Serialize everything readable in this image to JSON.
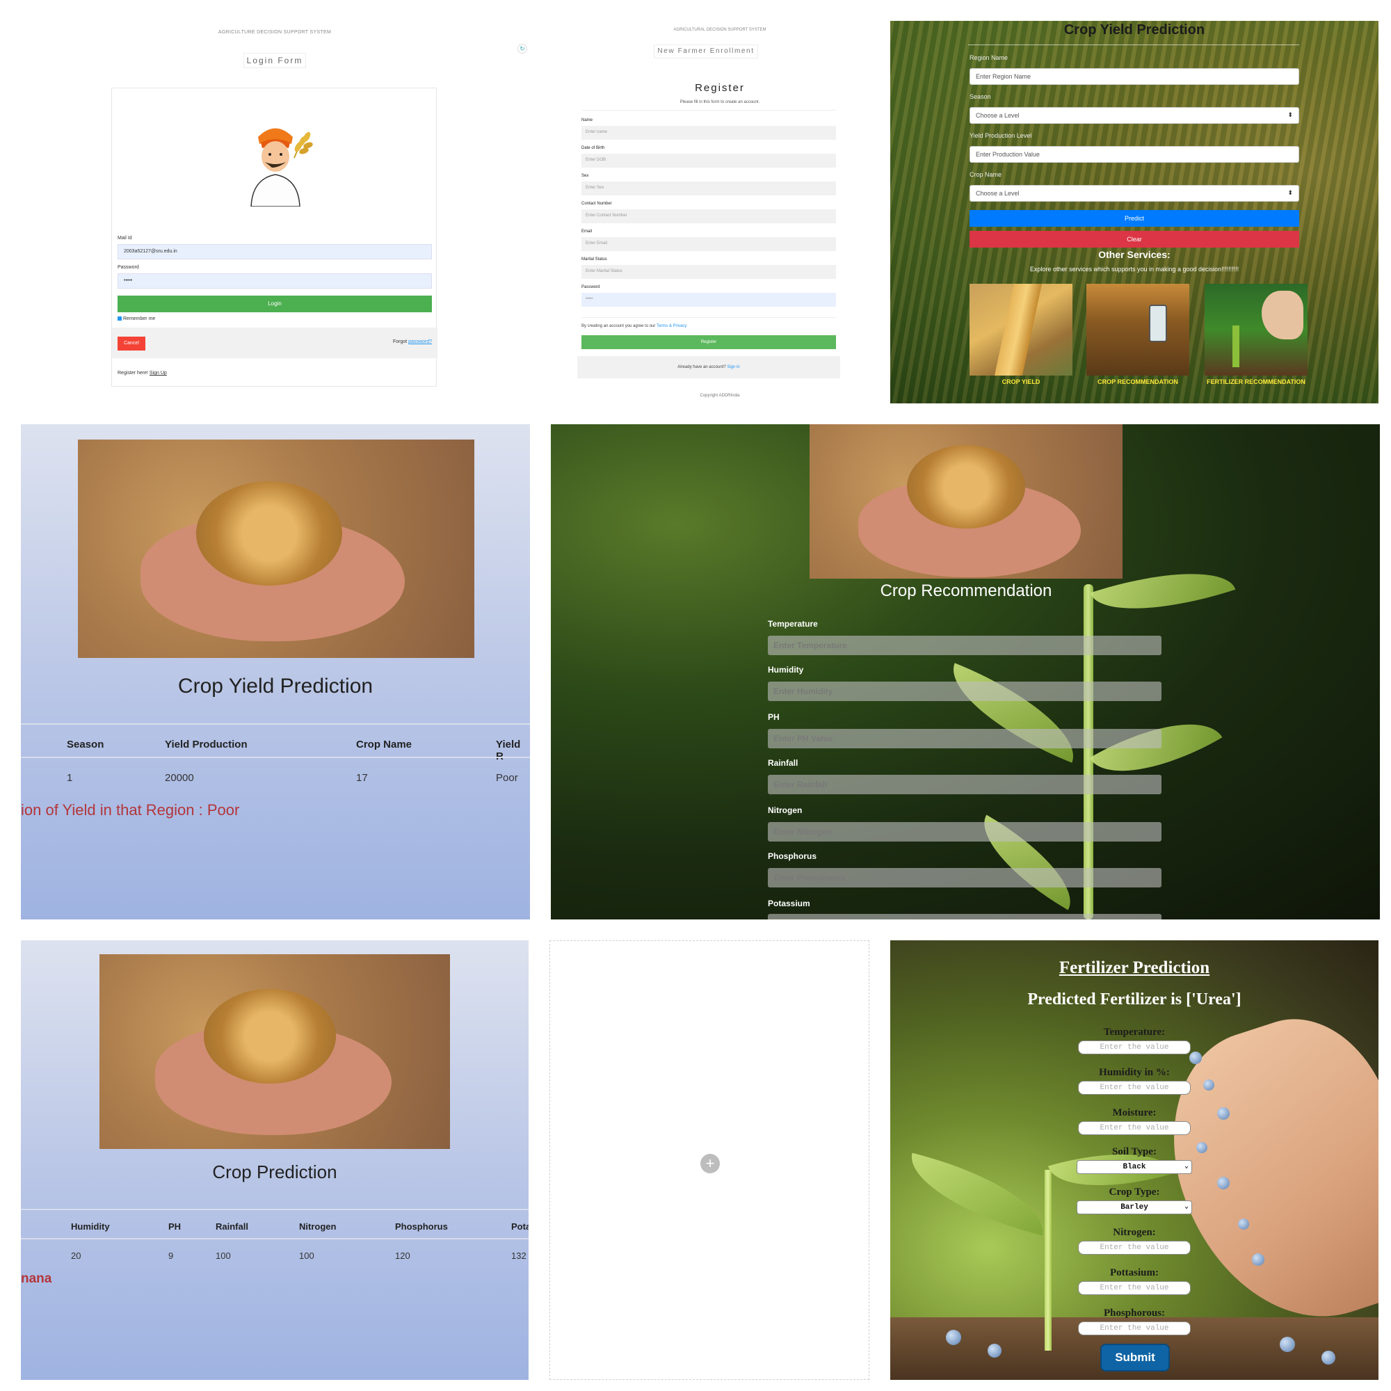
{
  "login": {
    "system_title": "AGRICULTURE DECISION SUPPORT SYSTEM",
    "form_title": "Login Form",
    "mail_label": "Mail Id",
    "mail_value": "2003a52127@sru.edu.in",
    "password_label": "Password",
    "password_value": "•••••",
    "login_button": "Login",
    "remember": "Remember me",
    "cancel_button": "Cancel",
    "forgot_prefix": "Forgot ",
    "forgot_link": "password?",
    "register_prefix": "Register here! ",
    "register_link": "Sign Up"
  },
  "register": {
    "system_title": "AGRICULTURAL DECISION SUPPORT SYSTEM",
    "enroll_title": "New Farmer Enrollment",
    "heading": "Register",
    "subheading": "Please fill in this form to create an account.",
    "fields": [
      {
        "label": "Name",
        "placeholder": "Enter name"
      },
      {
        "label": "Date of Birth",
        "placeholder": "Enter DOB"
      },
      {
        "label": "Sex",
        "placeholder": "Enter Sex"
      },
      {
        "label": "Contact Number",
        "placeholder": "Enter Contact Number"
      },
      {
        "label": "Email",
        "placeholder": "Enter Email"
      },
      {
        "label": "Marital Status",
        "placeholder": "Enter Marital Status"
      },
      {
        "label": "Password",
        "placeholder": "•••••"
      }
    ],
    "terms_prefix": "By creating an account you agree to our ",
    "terms_link": "Terms & Privacy",
    "register_button": "Register",
    "signin_prefix": "Already have an account? ",
    "signin_link": "Sign in",
    "copyright": "Copyright ADDRIndia"
  },
  "yield_form": {
    "title": "Crop Yield Prediction",
    "region_label": "Region Name",
    "region_placeholder": "Enter Region Name",
    "season_label": "Season",
    "season_value": "Choose a Level",
    "yield_label": "Yield Production Level",
    "yield_placeholder": "Enter Production Value",
    "crop_label": "Crop Name",
    "crop_value": "Choose a Level",
    "predict_button": "Predict",
    "clear_button": "Clear",
    "other_services": "Other Services:",
    "explore_text": "Explore other services which supports you in making a good decision!!!!!!!!!!",
    "services": [
      "CROP YIELD",
      "CROP RECOMMENDATION",
      "FERTILIZER RECOMMENDATION"
    ]
  },
  "yield_result": {
    "title": "Crop Yield Prediction",
    "headers": [
      "Season",
      "Yield Production",
      "Crop Name",
      "Yield R"
    ],
    "row": [
      "1",
      "20000",
      "17",
      "Poor"
    ],
    "result_text": "ion of Yield in that Region : Poor"
  },
  "crop_rec": {
    "title": "Crop Recommendation",
    "fields": [
      {
        "label": "Temperature",
        "placeholder": "Enter Temperature"
      },
      {
        "label": "Humidity",
        "placeholder": "Enter Humidity"
      },
      {
        "label": "PH",
        "placeholder": "Enter PH Value"
      },
      {
        "label": "Rainfall",
        "placeholder": "Enter Rainfall"
      },
      {
        "label": "Nitrogen",
        "placeholder": "Enter Nitrogen"
      },
      {
        "label": "Phosphorus",
        "placeholder": "Enter Phosphorus"
      },
      {
        "label": "Potassium",
        "placeholder": ""
      }
    ]
  },
  "crop_pred": {
    "title": "Crop Prediction",
    "headers": [
      "Humidity",
      "PH",
      "Rainfall",
      "Nitrogen",
      "Phosphorus",
      "Pota"
    ],
    "row": [
      "20",
      "9",
      "100",
      "100",
      "120",
      "132"
    ],
    "result_text": "nana"
  },
  "empty_panel": {
    "add_icon": "+"
  },
  "fertilizer": {
    "title": "Fertilizer Prediction",
    "predicted": "Predicted Fertilizer is ['Urea']",
    "fields": [
      {
        "label": "Temperature:",
        "placeholder": "Enter the value"
      },
      {
        "label": "Humidity in %:",
        "placeholder": "Enter the value"
      },
      {
        "label": "Moisture:",
        "placeholder": "Enter the value"
      }
    ],
    "soil_label": "Soil Type:",
    "soil_value": "Black",
    "crop_label": "Crop Type:",
    "crop_value": "Barley",
    "fields2": [
      {
        "label": "Nitrogen:",
        "placeholder": "Enter the value"
      },
      {
        "label": "Pottasium:",
        "placeholder": "Enter the value"
      },
      {
        "label": "Phosphorous:",
        "placeholder": "Enter the value"
      }
    ],
    "submit_button": "Submit"
  }
}
